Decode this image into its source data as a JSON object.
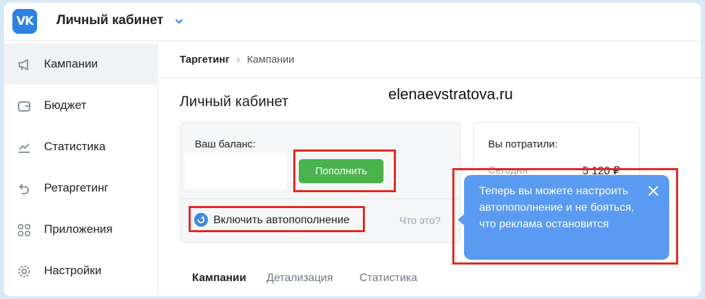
{
  "header": {
    "logo_text": "VK",
    "title": "Личный кабинет"
  },
  "sidebar": {
    "items": [
      {
        "label": "Кампании",
        "icon": "megaphone-icon",
        "active": true
      },
      {
        "label": "Бюджет",
        "icon": "wallet-icon"
      },
      {
        "label": "Статистика",
        "icon": "chart-trend-icon"
      },
      {
        "label": "Ретаргетинг",
        "icon": "retarget-arrow-icon"
      },
      {
        "label": "Приложения",
        "icon": "apps-grid-icon"
      },
      {
        "label": "Настройки",
        "icon": "gear-icon"
      }
    ]
  },
  "breadcrumb": {
    "first": "Таргетинг",
    "separator": "›",
    "second": "Кампании"
  },
  "page": {
    "title": "Личный кабинет",
    "watermark": "elenaevstratova.ru"
  },
  "balance_card": {
    "label": "Ваш баланс:",
    "topup_button": "Пополнить",
    "auto_topup_link": "Включить автопополнение",
    "what_is_it": "Что это?"
  },
  "spent_card": {
    "label": "Вы потратили:",
    "today_label": "Сегодня",
    "today_value": "5 120 ₽"
  },
  "tabs": [
    {
      "label": "Кампании",
      "active": true
    },
    {
      "label": "Детализация"
    },
    {
      "label": "Статистика"
    }
  ],
  "tooltip": {
    "text": "Теперь вы можете настроить автопополнение и не бояться, что реклама остановится"
  },
  "colors": {
    "accent": "#2d81e0",
    "button_green": "#4bb34b",
    "tooltip_blue": "#5a9af0",
    "highlight_red": "#e5261e"
  }
}
